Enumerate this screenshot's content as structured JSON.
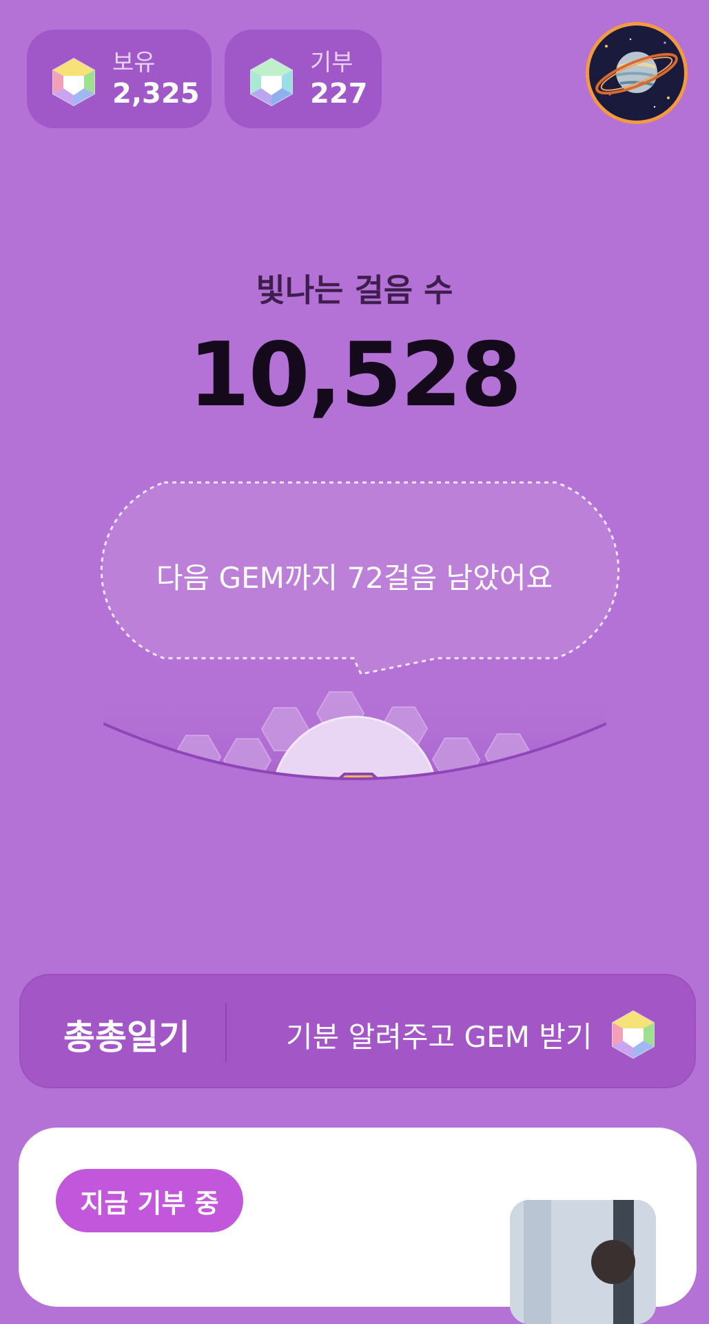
{
  "wallet": {
    "owned": {
      "label": "보유",
      "value": "2,325",
      "icon": "gem-icon"
    },
    "donated": {
      "label": "기부",
      "value": "227",
      "icon": "gem-icon"
    }
  },
  "profile": {
    "avatar_icon": "planet-avatar",
    "ring_color": "#f29a3c"
  },
  "steps": {
    "label": "빛나는 걸음 수",
    "value": "10,528",
    "next_gem_message": "다음 GEM까지 72걸음 남았어요"
  },
  "diary": {
    "title": "총총일기",
    "cta": "기분 알려주고 GEM 받기",
    "icon": "gem-icon"
  },
  "donation_card": {
    "badge": "지금 기부 중"
  },
  "colors": {
    "background": "#b472d6",
    "pill": "#a057c8",
    "badge": "#c257dc"
  }
}
